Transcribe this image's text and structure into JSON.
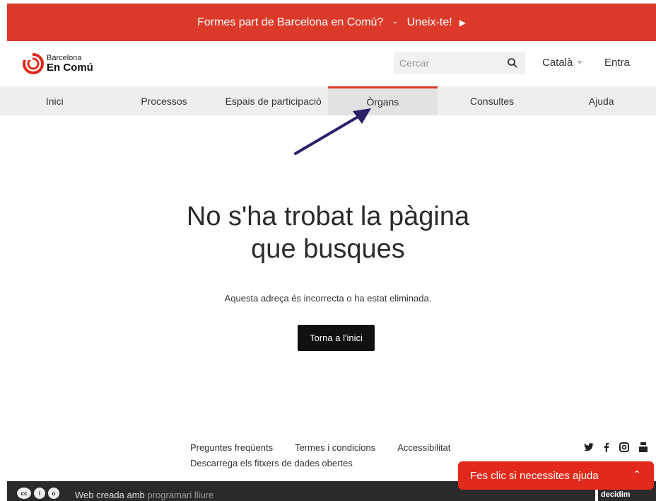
{
  "banner": {
    "text": "Formes part de Barcelona en Comú?",
    "separator": "-",
    "cta": "Uneix-te!"
  },
  "header": {
    "logo_line1": "Barcelona",
    "logo_line2": "En Comú",
    "search_placeholder": "Cercar",
    "language": "Català",
    "login": "Entra"
  },
  "nav": {
    "items": [
      {
        "label": "Inici"
      },
      {
        "label": "Processos"
      },
      {
        "label": "Espais de participació"
      },
      {
        "label": "Òrgans"
      },
      {
        "label": "Consultes"
      },
      {
        "label": "Ajuda"
      }
    ]
  },
  "main": {
    "title_line1": "No s'ha trobat la pàgina",
    "title_line2": "que busques",
    "subtitle": "Aquesta adreça és incorrecta o ha estat eliminada.",
    "home_button": "Torna a l'inici"
  },
  "footer": {
    "links_row1": [
      "Preguntes freqüents",
      "Termes i condicions",
      "Accessibilitat"
    ],
    "links_row2": [
      "Descarrega els fitxers de dades obertes"
    ],
    "made_with": "Web creada amb",
    "made_with_link": "programari lliure",
    "decidim": "decidim"
  },
  "help_widget": {
    "text": "Fes clic si necessites ajuda"
  },
  "colors": {
    "brand_red": "#db3a2a",
    "arrow": "#2e1f6b"
  }
}
